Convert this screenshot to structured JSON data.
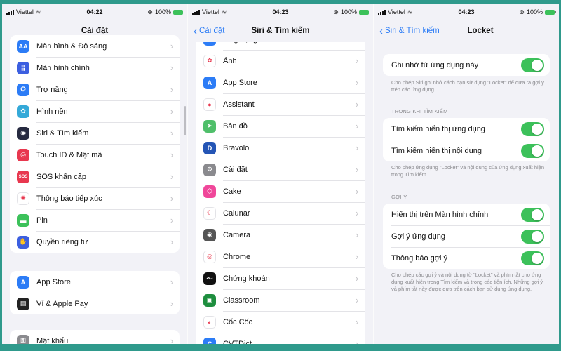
{
  "status": {
    "carrier": "Viettel",
    "battery": "100%",
    "times": [
      "04:22",
      "04:23",
      "04:23"
    ]
  },
  "screen1": {
    "title": "Cài đặt",
    "group1": [
      {
        "label": "Màn hình & Độ sáng",
        "icon": "display-brightness-icon",
        "color": "#2c7cf6",
        "glyph": "AA"
      },
      {
        "label": "Màn hình chính",
        "icon": "home-screen-icon",
        "color": "#3c5fe0",
        "glyph": "⣿"
      },
      {
        "label": "Trợ năng",
        "icon": "accessibility-icon",
        "color": "#2c7cf6",
        "glyph": "✪"
      },
      {
        "label": "Hình nền",
        "icon": "wallpaper-icon",
        "color": "#34a9d8",
        "glyph": "✿"
      },
      {
        "label": "Siri & Tìm kiếm",
        "icon": "siri-icon",
        "color": "#262a40",
        "glyph": "◉"
      },
      {
        "label": "Touch ID & Mật mã",
        "icon": "fingerprint-icon",
        "color": "#e8384f",
        "glyph": "◎"
      },
      {
        "label": "SOS khẩn cấp",
        "icon": "sos-icon",
        "color": "#e8384f",
        "glyph": "SOS"
      },
      {
        "label": "Thông báo tiếp xúc",
        "icon": "exposure-notification-icon",
        "color": "#ffffff",
        "glyph": "✺"
      },
      {
        "label": "Pin",
        "icon": "battery-icon",
        "color": "#3cc15a",
        "glyph": "▬"
      },
      {
        "label": "Quyền riêng tư",
        "icon": "privacy-hand-icon",
        "color": "#3c5fe0",
        "glyph": "✋"
      }
    ],
    "group2": [
      {
        "label": "App Store",
        "icon": "app-store-icon",
        "color": "#2c7cf6",
        "glyph": "A"
      },
      {
        "label": "Ví & Apple Pay",
        "icon": "wallet-icon",
        "color": "#222222",
        "glyph": "▤"
      }
    ],
    "group3": [
      {
        "label": "Mật khẩu",
        "icon": "key-icon",
        "color": "#8a8a8e",
        "glyph": "⚿"
      }
    ]
  },
  "screen2": {
    "back": "Cài đặt",
    "title": "Siri & Tìm kiếm",
    "apps": [
      {
        "label": "Ứng dụng thu nhỏ",
        "icon": "app-clips-icon",
        "color": "#2c7cf6",
        "glyph": "◫"
      },
      {
        "label": "Ảnh",
        "icon": "photos-icon",
        "color": "#ffffff",
        "glyph": "✿"
      },
      {
        "label": "App Store",
        "icon": "app-store-icon",
        "color": "#2c7cf6",
        "glyph": "A"
      },
      {
        "label": "Assistant",
        "icon": "google-assistant-icon",
        "color": "#ffffff",
        "glyph": "●"
      },
      {
        "label": "Bản đồ",
        "icon": "maps-icon",
        "color": "#4fbf6a",
        "glyph": "➤"
      },
      {
        "label": "Bravolol",
        "icon": "bravolol-icon",
        "color": "#2455b5",
        "glyph": "D"
      },
      {
        "label": "Cài đặt",
        "icon": "settings-gear-icon",
        "color": "#8a8a8e",
        "glyph": "⚙"
      },
      {
        "label": "Cake",
        "icon": "cake-icon",
        "color": "#f0479a",
        "glyph": "⬡"
      },
      {
        "label": "Calunar",
        "icon": "calunar-icon",
        "color": "#ffffff",
        "glyph": "☾"
      },
      {
        "label": "Camera",
        "icon": "camera-icon",
        "color": "#555555",
        "glyph": "◉"
      },
      {
        "label": "Chrome",
        "icon": "chrome-icon",
        "color": "#ffffff",
        "glyph": "◎"
      },
      {
        "label": "Chứng khoán",
        "icon": "stocks-icon",
        "color": "#111111",
        "glyph": "〜"
      },
      {
        "label": "Classroom",
        "icon": "classroom-icon",
        "color": "#1e8e3e",
        "glyph": "▣"
      },
      {
        "label": "Cốc Cốc",
        "icon": "coccoc-icon",
        "color": "#ffffff",
        "glyph": "◐"
      },
      {
        "label": "CVTDict",
        "icon": "cvtdict-icon",
        "color": "#2c7cf6",
        "glyph": "C"
      }
    ]
  },
  "screen3": {
    "back": "Siri & Tìm kiếm",
    "title": "Locket",
    "learn": {
      "label": "Ghi nhớ từ ứng dụng này",
      "on": true
    },
    "learn_footer": "Cho phép Siri ghi nhớ cách bạn sử dụng \"Locket\" để đưa ra gợi ý trên các ứng dụng.",
    "search_header": "TRONG KHI TÌM KIẾM",
    "search_rows": [
      {
        "label": "Tìm kiếm hiển thị ứng dụng",
        "on": true
      },
      {
        "label": "Tìm kiếm hiển thị nội dung",
        "on": true
      }
    ],
    "search_footer": "Cho phép ứng dụng \"Locket\" và nội dung của ứng dụng xuất hiện trong Tìm kiếm.",
    "suggest_header": "GỢI Ý",
    "suggest_rows": [
      {
        "label": "Hiển thị trên Màn hình chính",
        "on": true
      },
      {
        "label": "Gợi ý ứng dụng",
        "on": true
      },
      {
        "label": "Thông báo gợi ý",
        "on": true
      }
    ],
    "suggest_footer": "Cho phép các gợi ý và nội dung từ \"Locket\" và phím tắt cho ứng dụng xuất hiện trong Tìm kiếm và trong các tiện ích. Những gợi ý và phím tắt này được dựa trên cách bạn sử dụng ứng dụng."
  }
}
